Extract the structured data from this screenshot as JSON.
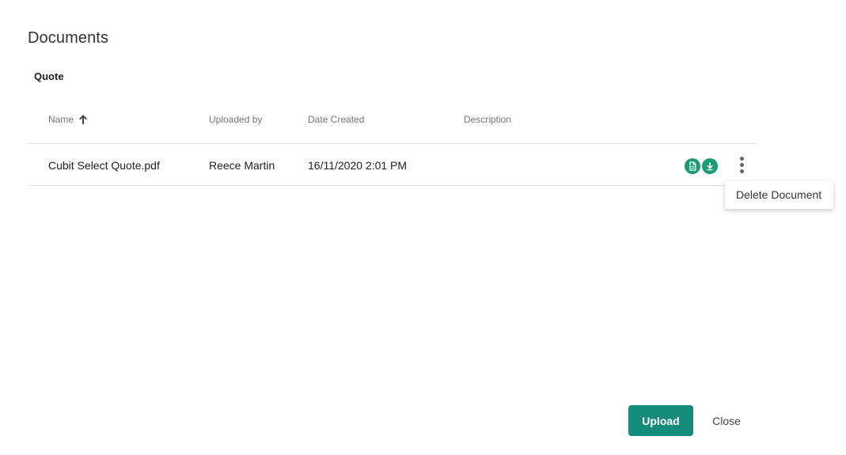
{
  "dialog": {
    "title": "Documents",
    "section_title": "Quote"
  },
  "table": {
    "columns": {
      "name": "Name",
      "uploaded_by": "Uploaded by",
      "date_created": "Date Created",
      "description": "Description"
    },
    "sort": {
      "column": "name",
      "direction": "ascending",
      "icon": "arrow-up-icon"
    },
    "rows": [
      {
        "name": "Cubit Select Quote.pdf",
        "uploaded_by": "Reece Martin",
        "date_created": "16/11/2020 2:01 PM",
        "description": ""
      }
    ],
    "row_actions": {
      "view_icon": "document-icon",
      "download_icon": "download-icon",
      "more_icon": "more-vertical-icon",
      "icon_color": "#1a9c74"
    }
  },
  "context_menu": {
    "items": [
      "Delete Document"
    ]
  },
  "footer": {
    "upload_label": "Upload",
    "close_label": "Close",
    "upload_color": "#138c7c"
  }
}
